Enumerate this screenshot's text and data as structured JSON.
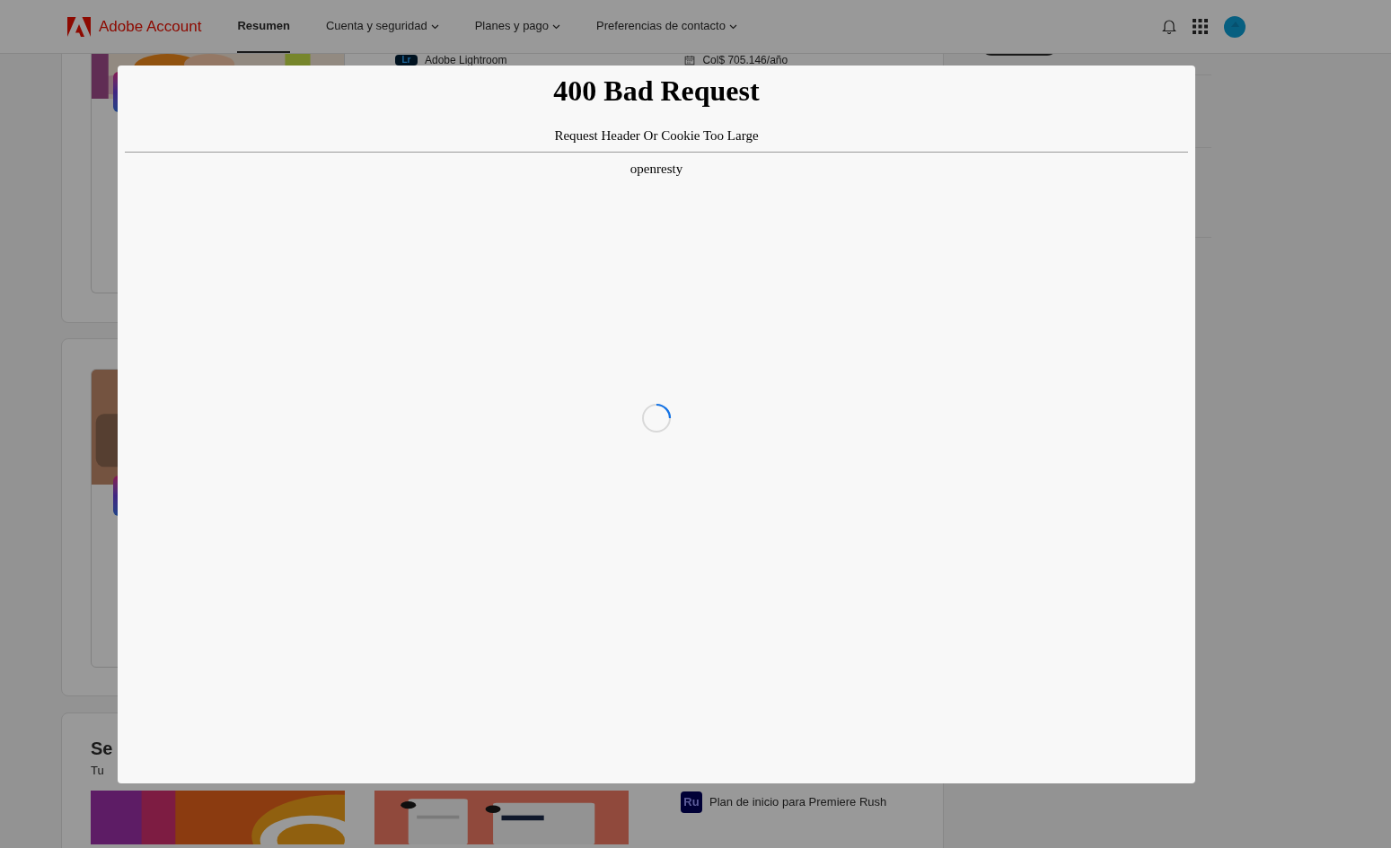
{
  "header": {
    "brand": "Adobe Account",
    "nav": [
      {
        "label": "Resumen",
        "selected": true,
        "dropdown": false
      },
      {
        "label": "Cuenta y seguridad",
        "selected": false,
        "dropdown": true
      },
      {
        "label": "Planes y pago",
        "selected": false,
        "dropdown": true
      },
      {
        "label": "Preferencias de contacto",
        "selected": false,
        "dropdown": true
      }
    ]
  },
  "background": {
    "plan_row": {
      "product": "Adobe Lightroom",
      "product_icon": "Lr",
      "price": "Col$ 705.146/año"
    },
    "section": {
      "title": "Se",
      "subtitle": "Tu",
      "list": [
        {
          "icon": "Ru",
          "label": "Plan de inicio para Premiere Rush"
        }
      ]
    }
  },
  "dialog": {
    "title": "400 Bad Request",
    "message": "Request Header Or Cookie Too Large",
    "footer": "openresty",
    "loading": true
  }
}
